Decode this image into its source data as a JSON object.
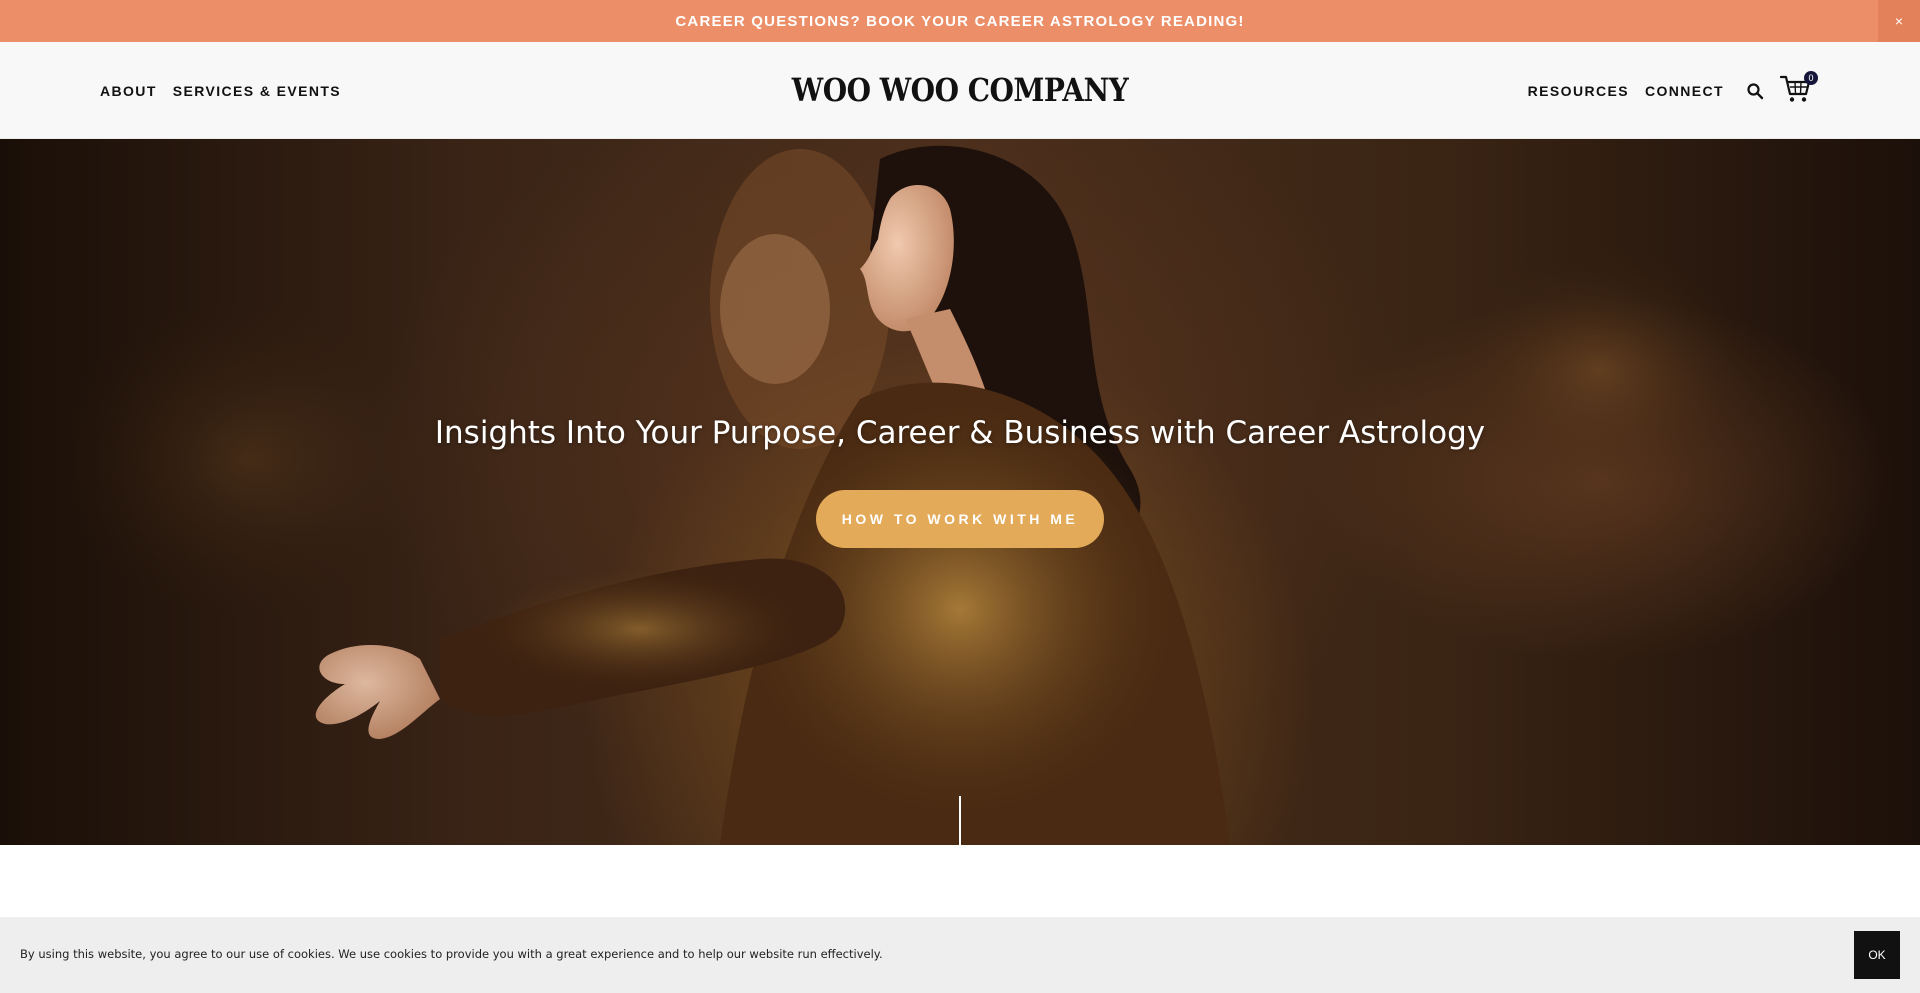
{
  "announcement": {
    "text": "CAREER QUESTIONS? BOOK YOUR CAREER ASTROLOGY READING!",
    "close_symbol": "×",
    "background": "#ec8f68"
  },
  "header": {
    "nav_left": [
      {
        "label": "ABOUT"
      },
      {
        "label": "SERVICES & EVENTS"
      }
    ],
    "logo": "WOO WOO COMPANY",
    "nav_right": [
      {
        "label": "RESOURCES"
      },
      {
        "label": "CONNECT"
      }
    ],
    "search_icon": "search-icon",
    "cart_icon": "cart-icon",
    "cart_count": "0"
  },
  "hero": {
    "title": "Insights Into Your Purpose, Career & Business with Career Astrology",
    "button_label": "HOW TO WORK WITH ME",
    "button_color": "#e3aa59"
  },
  "cookie_banner": {
    "text": "By using this website, you agree to our use of cookies. We use cookies to provide you with a great experience and to help our website run effectively.",
    "ok_label": "OK"
  }
}
